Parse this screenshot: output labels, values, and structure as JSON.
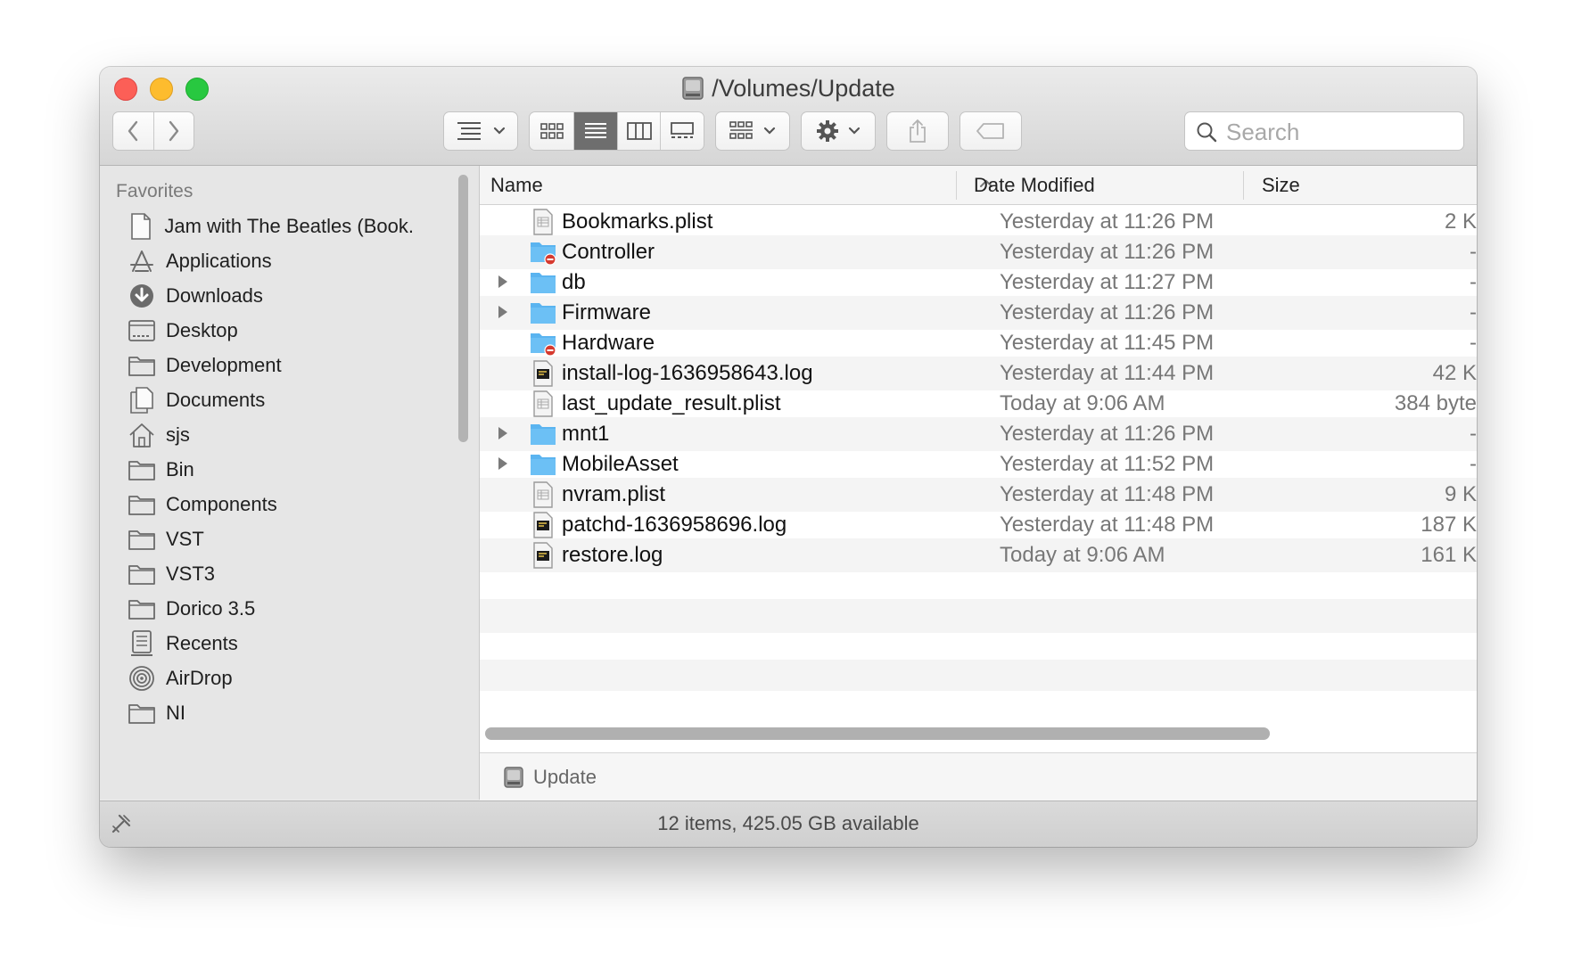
{
  "window": {
    "title": "/Volumes/Update"
  },
  "toolbar": {
    "search_placeholder": "Search",
    "active_view": "list"
  },
  "sidebar": {
    "heading": "Favorites",
    "items": [
      {
        "label": "Jam with The Beatles (Book...",
        "icon": "document-icon"
      },
      {
        "label": "Applications",
        "icon": "applications-icon"
      },
      {
        "label": "Downloads",
        "icon": "downloads-icon"
      },
      {
        "label": "Desktop",
        "icon": "desktop-icon"
      },
      {
        "label": "Development",
        "icon": "folder-icon"
      },
      {
        "label": "Documents",
        "icon": "documents-icon"
      },
      {
        "label": "sjs",
        "icon": "home-icon"
      },
      {
        "label": "Bin",
        "icon": "folder-icon"
      },
      {
        "label": "Components",
        "icon": "folder-icon"
      },
      {
        "label": "VST",
        "icon": "folder-icon"
      },
      {
        "label": "VST3",
        "icon": "folder-icon"
      },
      {
        "label": "Dorico 3.5",
        "icon": "folder-icon"
      },
      {
        "label": "Recents",
        "icon": "recents-icon"
      },
      {
        "label": "AirDrop",
        "icon": "airdrop-icon"
      },
      {
        "label": "NI",
        "icon": "folder-icon"
      }
    ]
  },
  "columns": {
    "name": "Name",
    "date": "Date Modified",
    "size": "Size"
  },
  "files": [
    {
      "name": "Bookmarks.plist",
      "date": "Yesterday at 11:26 PM",
      "size": "2 K",
      "kind": "plist",
      "expandable": false
    },
    {
      "name": "Controller",
      "date": "Yesterday at 11:26 PM",
      "size": "-",
      "kind": "folder-restricted",
      "expandable": false
    },
    {
      "name": "db",
      "date": "Yesterday at 11:27 PM",
      "size": "-",
      "kind": "folder",
      "expandable": true
    },
    {
      "name": "Firmware",
      "date": "Yesterday at 11:26 PM",
      "size": "-",
      "kind": "folder",
      "expandable": true
    },
    {
      "name": "Hardware",
      "date": "Yesterday at 11:45 PM",
      "size": "-",
      "kind": "folder-restricted",
      "expandable": false
    },
    {
      "name": "install-log-1636958643.log",
      "date": "Yesterday at 11:44 PM",
      "size": "42 K",
      "kind": "log",
      "expandable": false
    },
    {
      "name": "last_update_result.plist",
      "date": "Today at 9:06 AM",
      "size": "384 byte",
      "kind": "plist",
      "expandable": false
    },
    {
      "name": "mnt1",
      "date": "Yesterday at 11:26 PM",
      "size": "-",
      "kind": "folder",
      "expandable": true
    },
    {
      "name": "MobileAsset",
      "date": "Yesterday at 11:52 PM",
      "size": "-",
      "kind": "folder",
      "expandable": true
    },
    {
      "name": "nvram.plist",
      "date": "Yesterday at 11:48 PM",
      "size": "9 K",
      "kind": "plist",
      "expandable": false
    },
    {
      "name": "patchd-1636958696.log",
      "date": "Yesterday at 11:48 PM",
      "size": "187 K",
      "kind": "log",
      "expandable": false
    },
    {
      "name": "restore.log",
      "date": "Today at 9:06 AM",
      "size": "161 K",
      "kind": "log",
      "expandable": false
    }
  ],
  "path_bar": {
    "label": "Update"
  },
  "status": {
    "text": "12 items, 425.05 GB available"
  },
  "colors": {
    "folder": "#5ab4f0",
    "restricted": "#d63a2f",
    "close": "#fc5f57",
    "minimize": "#fdbc2e",
    "maximize": "#28c840"
  }
}
